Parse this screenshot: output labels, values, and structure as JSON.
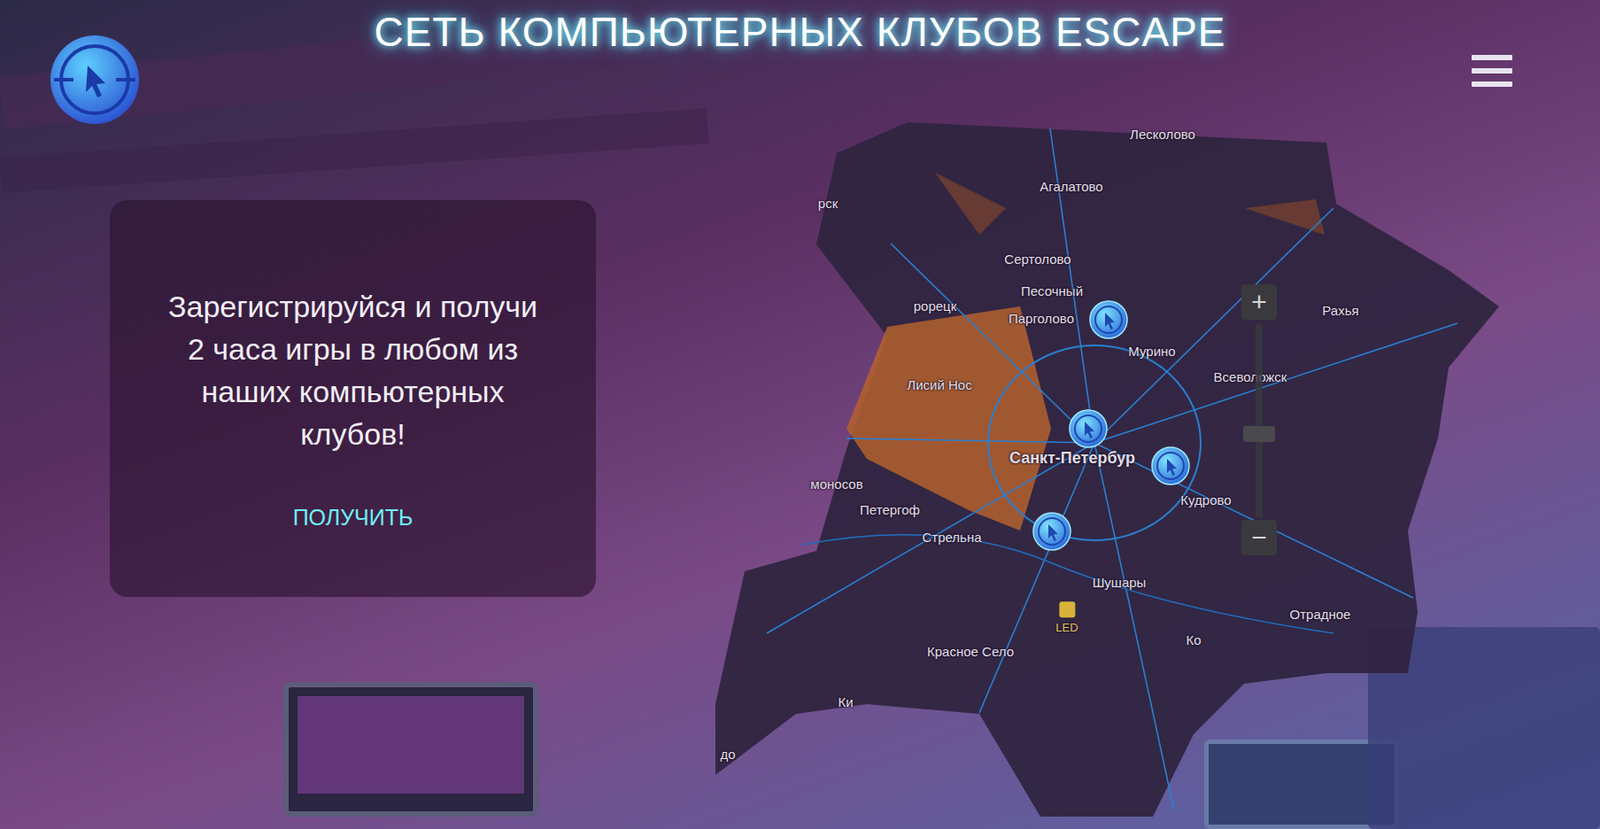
{
  "header": {
    "title": "СЕТЬ КОМПЬЮТЕРНЫХ КЛУБОВ ESCAPE"
  },
  "promo": {
    "text": "Зарегистрируйся и получи 2 часа игры в любом из наших компьютерных клубов!",
    "button": "ПОЛУЧИТЬ"
  },
  "map": {
    "labels": [
      {
        "text": "Лесколово",
        "kind": "town"
      },
      {
        "text": "Агалатово",
        "kind": "town"
      },
      {
        "text": "рск",
        "kind": "town"
      },
      {
        "text": "Сертолово",
        "kind": "town"
      },
      {
        "text": "Песочный",
        "kind": "town"
      },
      {
        "text": "рорецк",
        "kind": "town"
      },
      {
        "text": "Парголово",
        "kind": "town"
      },
      {
        "text": "Мурино",
        "kind": "town"
      },
      {
        "text": "Рахья",
        "kind": "town"
      },
      {
        "text": "Всеволожск",
        "kind": "town"
      },
      {
        "text": "Лисий Нос",
        "kind": "town"
      },
      {
        "text": "Санкт-Петербур",
        "kind": "city"
      },
      {
        "text": "Кудрово",
        "kind": "town"
      },
      {
        "text": "моносов",
        "kind": "town"
      },
      {
        "text": "Петергоф",
        "kind": "town"
      },
      {
        "text": "Стрельна",
        "kind": "town"
      },
      {
        "text": "Шушары",
        "kind": "town"
      },
      {
        "text": "LED",
        "kind": "airport"
      },
      {
        "text": "Отрадное",
        "kind": "town"
      },
      {
        "text": "Красное Село",
        "kind": "town"
      },
      {
        "text": "Ки",
        "kind": "town"
      },
      {
        "text": "Ко",
        "kind": "town"
      },
      {
        "text": "до",
        "kind": "town"
      }
    ],
    "zoom": {
      "in": "+",
      "out": "−"
    }
  }
}
